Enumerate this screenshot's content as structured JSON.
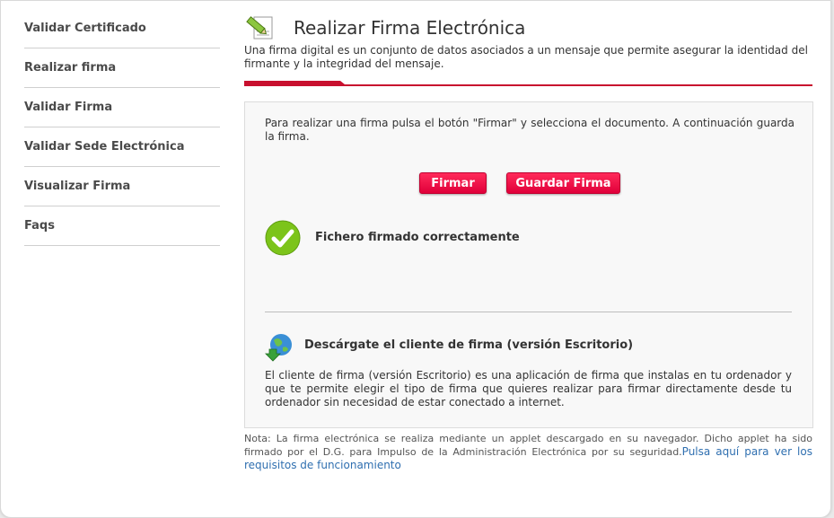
{
  "sidebar": {
    "items": [
      {
        "label": "Validar Certificado"
      },
      {
        "label": "Realizar firma"
      },
      {
        "label": "Validar Firma"
      },
      {
        "label": "Validar Sede Electrónica"
      },
      {
        "label": "Visualizar Firma"
      },
      {
        "label": "Faqs"
      }
    ]
  },
  "header": {
    "title": "Realizar Firma Electrónica",
    "icon": "sign-document-icon",
    "intro": "Una firma digital es un conjunto de datos asociados a un mensaje que permite asegurar la identidad del firmante y la integridad del mensaje."
  },
  "main": {
    "instructions": "Para realizar una firma pulsa el botón \"Firmar\" y selecciona el documento. A continuación guarda la firma.",
    "buttons": {
      "sign": "Firmar",
      "save": "Guardar Firma"
    },
    "status": {
      "icon": "success-check-icon",
      "text": "Fichero firmado correctamente"
    },
    "download": {
      "icon": "globe-download-icon",
      "title": "Descárgate el cliente de firma (versión Escritorio)",
      "description": "El cliente de firma (versión Escritorio) es una aplicación de firma que instalas en tu ordenador y que te permite elegir el tipo de firma que quieres realizar para firmar directamente desde tu ordenador sin necesidad de estar conectado a internet."
    }
  },
  "note": {
    "text": "Nota: La firma electrónica se realiza mediante un applet descargado en su navegador. Dicho applet ha sido firmado por el D.G. para Impulso de la Administración Electrónica por su seguridad.",
    "link": "Pulsa aquí para ver los requisitos de funcionamiento"
  },
  "colors": {
    "accent": "#e0003a",
    "link": "#2f6fb0",
    "success": "#7cc41a"
  }
}
